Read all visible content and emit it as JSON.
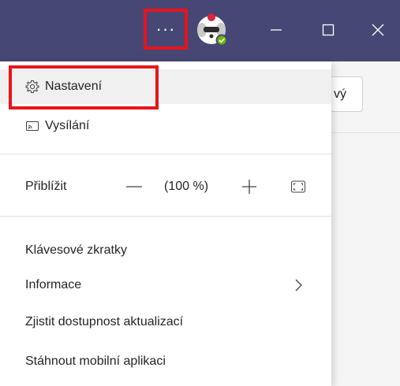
{
  "titlebar": {
    "more_label": "···",
    "window_controls": [
      "minimize-icon",
      "maximize-icon",
      "close-icon"
    ],
    "accent_color": "#464775",
    "presence": "available"
  },
  "background": {
    "button_fragment": "vý"
  },
  "menu": {
    "settings": "Nastavení",
    "broadcast": "Vysílání",
    "zoom": {
      "label": "Přiblížit",
      "minus": "—",
      "value": "(100 %)",
      "plus": "+"
    },
    "shortcuts": "Klávesové zkratky",
    "about": "Informace",
    "check_updates": "Zjistit dostupnost aktualizací",
    "download_mobile": "Stáhnout mobilní aplikaci"
  },
  "colors": {
    "highlight": "#e8141a",
    "presence_green": "#6bb700"
  }
}
